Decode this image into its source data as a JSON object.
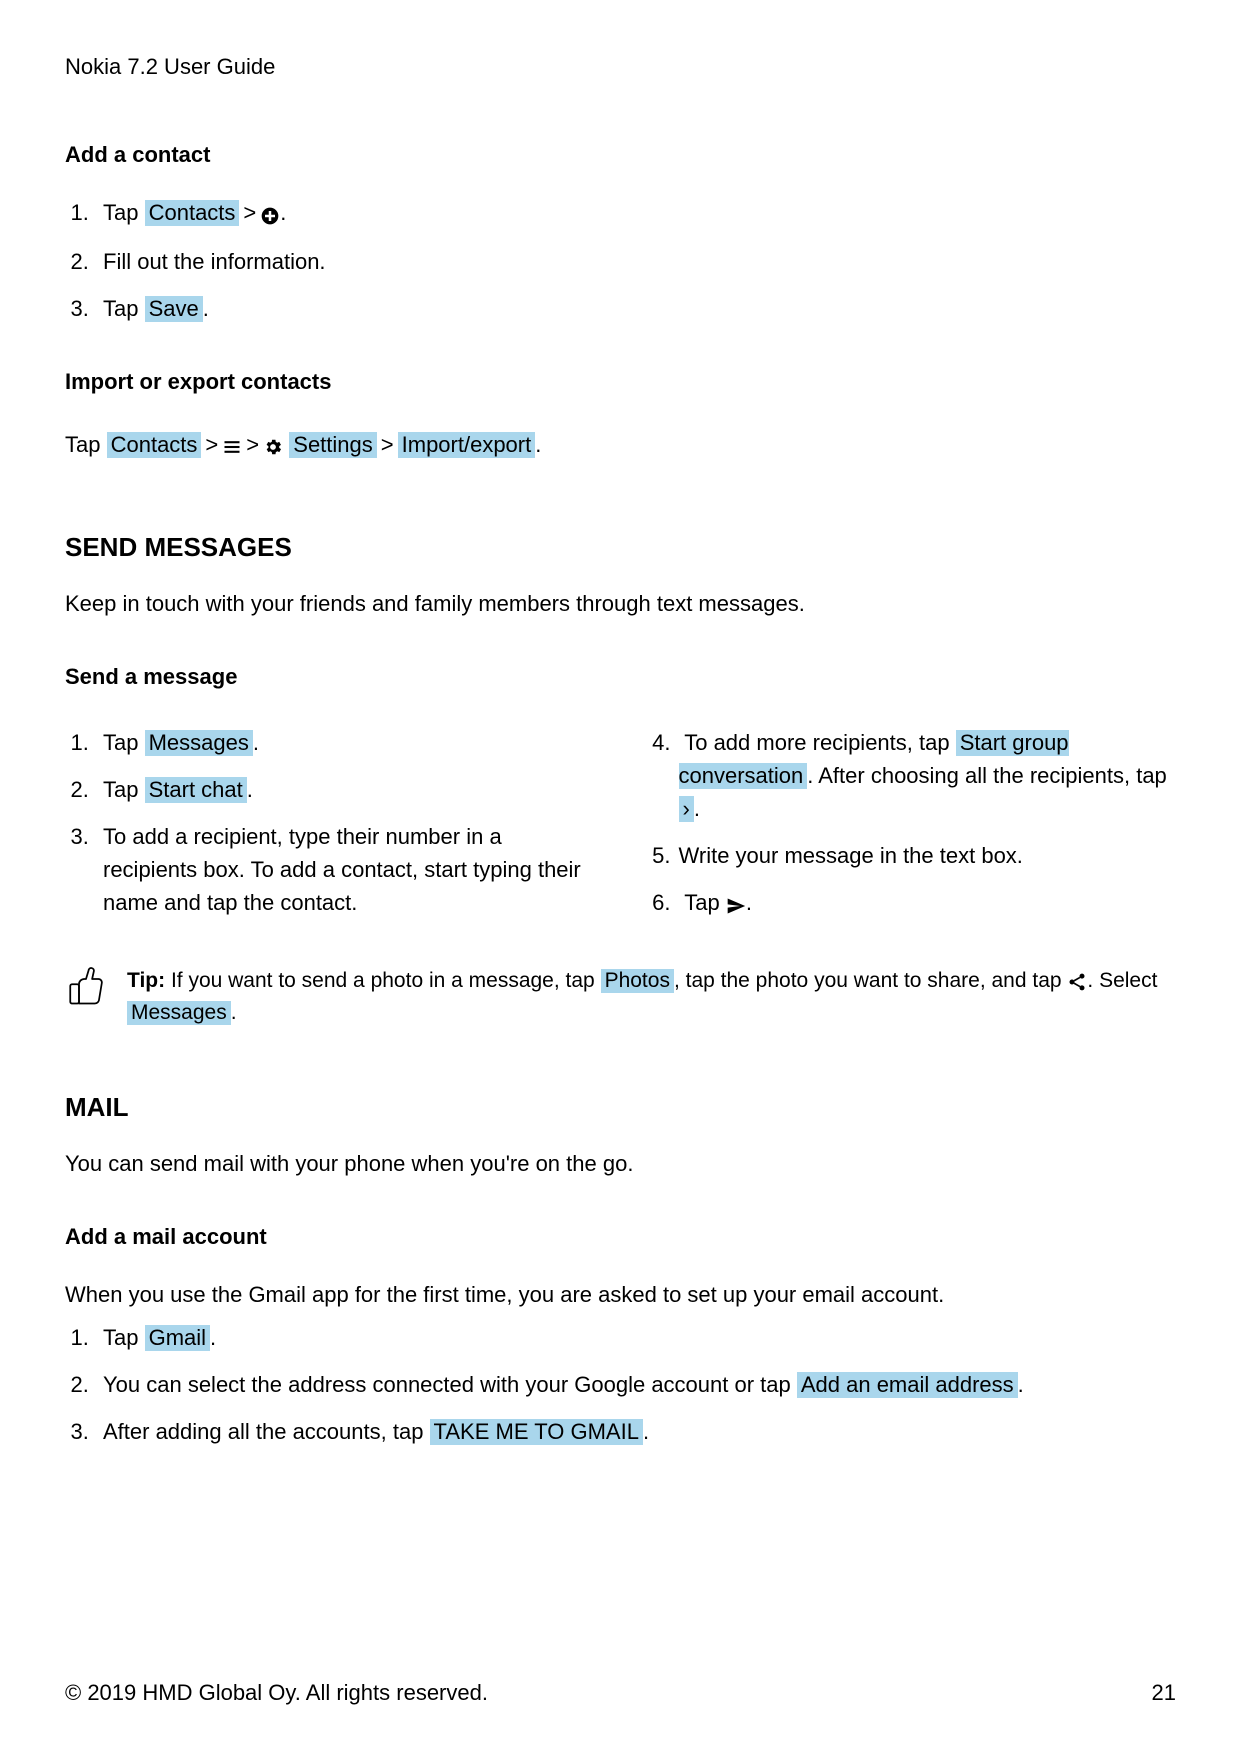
{
  "header": "Nokia 7.2 User Guide",
  "add_contact": {
    "title": "Add a contact",
    "s1_a": "Tap ",
    "s1_btn": "Contacts",
    "s1_b": " > ",
    "s1_c": ".",
    "s2": "Fill out the information.",
    "s3_a": "Tap ",
    "s3_btn": "Save",
    "s3_b": "."
  },
  "import_export": {
    "title": "Import or export contacts",
    "a": "Tap ",
    "btn1": "Contacts",
    "b": " > ",
    "c": " > ",
    "btn2": "Settings",
    "d": " > ",
    "btn3": "Import/export",
    "e": "."
  },
  "send_messages": {
    "title": "SEND MESSAGES",
    "intro": "Keep in touch with your friends and family members through text messages.",
    "send_a_message": "Send a message",
    "s1_a": "Tap ",
    "s1_btn": "Messages",
    "s1_b": ".",
    "s2_a": "Tap ",
    "s2_btn": "Start chat",
    "s2_b": ".",
    "s3": "To add a recipient, type their number in a recipients box. To add a contact, start typing their name and tap the contact.",
    "s4_a": "To add more recipients, tap ",
    "s4_btn": "Start group conversation",
    "s4_b": ". After choosing all the recipients, tap ",
    "s4_btn2": "›",
    "s4_c": ".",
    "s5": "Write your message in the text box.",
    "s6_a": "Tap ",
    "s6_b": ".",
    "tip_label": "Tip:",
    "tip_a": " If you want to send a photo in a message, tap ",
    "tip_btn1": "Photos",
    "tip_b": ", tap the photo you want to share, and tap ",
    "tip_c": ". Select ",
    "tip_btn2": "Messages",
    "tip_d": "."
  },
  "mail": {
    "title": "MAIL",
    "intro": "You can send mail with your phone when you're on the go.",
    "add_account": "Add a mail account",
    "intro2": "When you use the Gmail app for the first time, you are asked to set up your email account.",
    "s1_a": "Tap ",
    "s1_btn": "Gmail",
    "s1_b": ".",
    "s2_a": "You can select the address connected with your Google account or tap ",
    "s2_btn": "Add an email address",
    "s2_b": ".",
    "s3_a": "After adding all the accounts, tap ",
    "s3_btn": "TAKE ME TO GMAIL",
    "s3_b": "."
  },
  "footer": {
    "copyright": "© 2019 HMD Global Oy. All rights reserved.",
    "page": "21"
  }
}
